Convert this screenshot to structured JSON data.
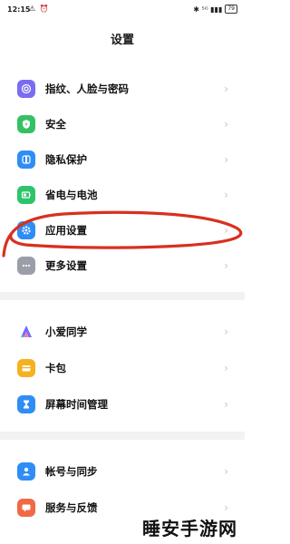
{
  "status": {
    "time": "12:15",
    "left_icons": "⚠ ⏰",
    "right_icons": "✱ ⁵ᴳ ▮▮▮",
    "battery": "79"
  },
  "header": {
    "title": "设置"
  },
  "group1": {
    "items": [
      {
        "label": "指纹、人脸与密码",
        "icon": "fingerprint-icon",
        "color": "#7a6cf0"
      },
      {
        "label": "安全",
        "icon": "shield-icon",
        "color": "#35c163"
      },
      {
        "label": "隐私保护",
        "icon": "privacy-icon",
        "color": "#2f8df5"
      },
      {
        "label": "省电与电池",
        "icon": "battery-icon",
        "color": "#2ec46b"
      },
      {
        "label": "应用设置",
        "icon": "gear-icon",
        "color": "#2f8df5"
      },
      {
        "label": "更多设置",
        "icon": "more-icon",
        "color": "#9a9ea8"
      }
    ]
  },
  "group2": {
    "items": [
      {
        "label": "小爱同学",
        "icon": "xiaoai-icon",
        "color": "#6f6cff"
      },
      {
        "label": "卡包",
        "icon": "wallet-icon",
        "color": "#f5b21e"
      },
      {
        "label": "屏幕时间管理",
        "icon": "hourglass-icon",
        "color": "#2f8df5"
      }
    ]
  },
  "group3": {
    "items": [
      {
        "label": "帐号与同步",
        "icon": "account-icon",
        "color": "#2f8df5"
      },
      {
        "label": "服务与反馈",
        "icon": "feedback-icon",
        "color": "#f06a44"
      }
    ]
  },
  "watermark": "睡安手游网"
}
